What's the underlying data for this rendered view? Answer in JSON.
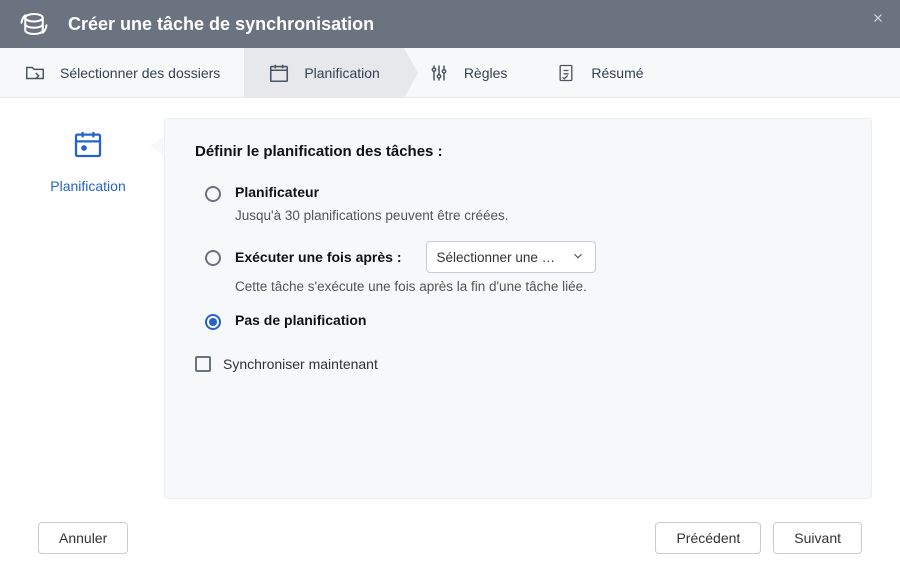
{
  "header": {
    "title": "Créer une tâche de synchronisation"
  },
  "steps": {
    "select_folders": "Sélectionner des dossiers",
    "planning": "Planification",
    "rules": "Règles",
    "summary": "Résumé"
  },
  "sidebar": {
    "label": "Planification"
  },
  "panel": {
    "heading": "Définir le planification des tâches :",
    "options": {
      "scheduler": {
        "label": "Planificateur",
        "description": "Jusqu'à 30 planifications peuvent être créées."
      },
      "run_once_after": {
        "label": "Exécuter une fois après :",
        "select_placeholder": "Sélectionner une …",
        "description": "Cette tâche s'exécute une fois après la fin d'une tâche liée."
      },
      "no_schedule": {
        "label": "Pas de planification"
      }
    },
    "sync_now_label": "Synchroniser maintenant"
  },
  "footer": {
    "cancel": "Annuler",
    "previous": "Précédent",
    "next": "Suivant"
  }
}
